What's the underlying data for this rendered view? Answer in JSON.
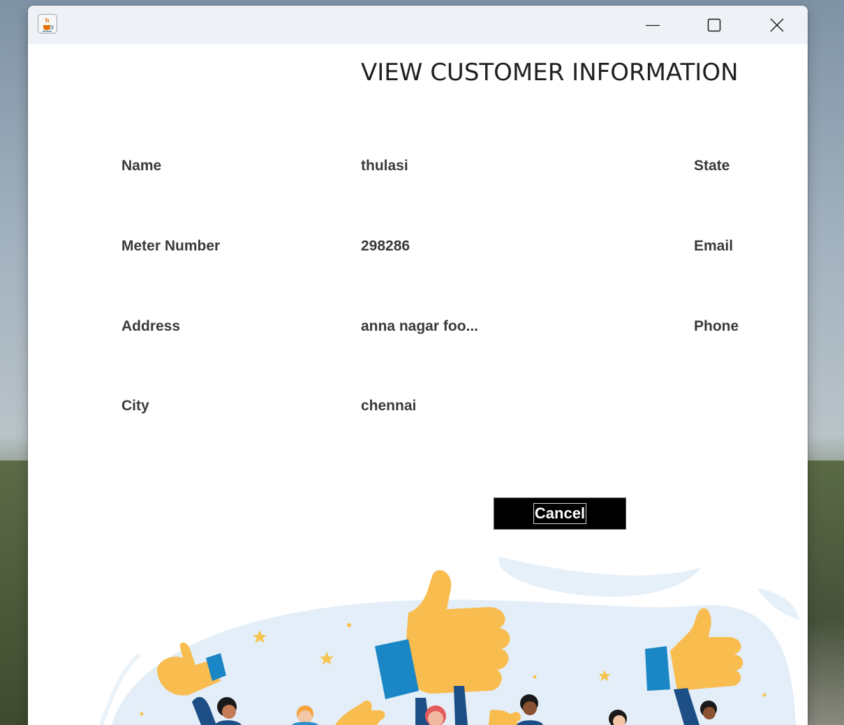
{
  "window": {
    "app_icon": "java-cup-icon",
    "controls": {
      "minimize": "minimize-icon",
      "maximize": "maximize-icon",
      "close": "close-icon"
    }
  },
  "heading": "VIEW CUSTOMER INFORMATION",
  "fields": {
    "name_label": "Name",
    "name_value": "thulasi",
    "meter_label": "Meter Number",
    "meter_value": "298286",
    "address_label": "Address",
    "address_value": "anna nagar foo...",
    "city_label": "City",
    "city_value": "chennai",
    "state_label": "State",
    "email_label": "Email",
    "phone_label": "Phone"
  },
  "cancel_button": "Cancel",
  "colors": {
    "button_bg": "#000000",
    "thumb": "#f9bc4f",
    "cuff": "#1b86c6",
    "wave": "#e3eef8"
  }
}
